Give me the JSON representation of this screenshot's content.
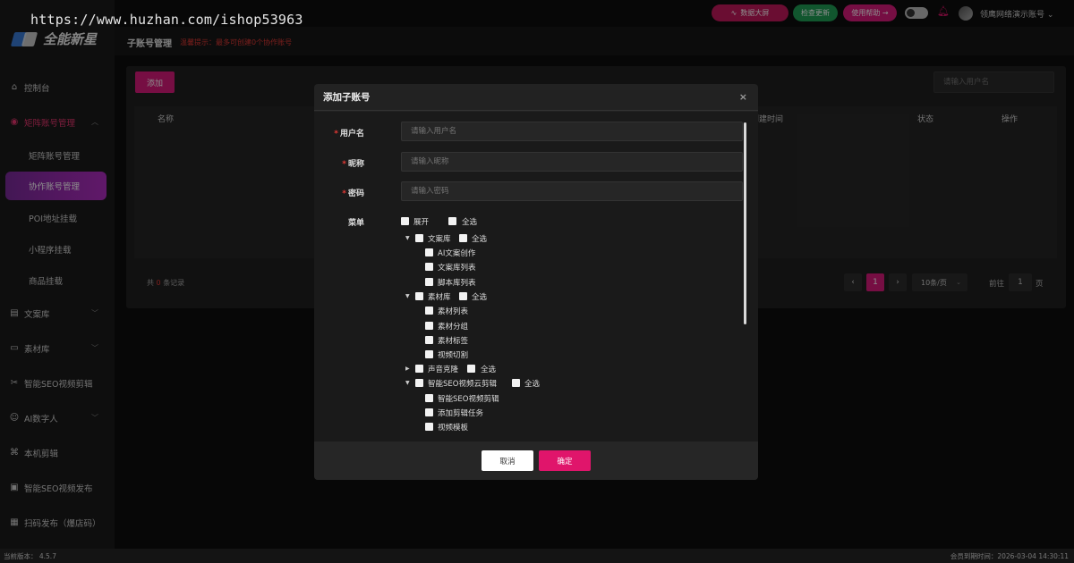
{
  "watermark": "https://www.huzhan.com/ishop53963",
  "brand": {
    "name": "全能新星"
  },
  "topbar": {
    "dashboard_label": "数据大屏",
    "check_update_label": "检查更新",
    "help_label": "使用帮助 →",
    "account_name": "领鹰网络演示账号",
    "account_chevron": "⌄"
  },
  "sidebar": {
    "items": [
      {
        "label": "控制台",
        "icon": "home-icon"
      },
      {
        "label": "矩阵账号管理",
        "icon": "matrix-icon",
        "expanded": true,
        "children": [
          "矩阵账号管理",
          "协作账号管理",
          "POI地址挂载",
          "小程序挂载",
          "商品挂载"
        ]
      },
      {
        "label": "文案库",
        "icon": "document-icon"
      },
      {
        "label": "素材库",
        "icon": "folder-icon"
      },
      {
        "label": "智能SEO视频剪辑",
        "icon": "scissors-icon"
      },
      {
        "label": "AI数字人",
        "icon": "ai-icon"
      },
      {
        "label": "本机剪辑",
        "icon": "cut-icon"
      },
      {
        "label": "智能SEO视频发布",
        "icon": "video-icon"
      },
      {
        "label": "扫码发布（爆店码）",
        "icon": "qrcode-icon"
      }
    ]
  },
  "header": {
    "title": "子账号管理",
    "tip": "温馨提示：最多可创建0个协作账号"
  },
  "main": {
    "add_label": "添加",
    "search_placeholder": "请输入用户名",
    "columns": [
      "名称",
      "创建时间",
      "状态",
      "操作"
    ],
    "total_prefix": "共",
    "total_count": "0",
    "total_suffix": "条记录",
    "pager": {
      "prev": "‹",
      "current": "1",
      "next": "›",
      "page_size": "10条/页",
      "goto_label": "前往",
      "goto_value": "1",
      "page_unit": "页"
    }
  },
  "modal": {
    "title": "添加子账号",
    "close": "×",
    "fields": {
      "username": {
        "label": "用户名",
        "placeholder": "请输入用户名"
      },
      "nickname": {
        "label": "昵称",
        "placeholder": "请输入昵称"
      },
      "password": {
        "label": "密码",
        "placeholder": "请输入密码"
      }
    },
    "menu_label": "菜单",
    "menu_top": {
      "expand": "展开",
      "select_all": "全选"
    },
    "select_all": "全选",
    "groups": [
      {
        "name": "文案库",
        "children": [
          "AI文案创作",
          "文案库列表",
          "脚本库列表"
        ]
      },
      {
        "name": "素材库",
        "children": [
          "素材列表",
          "素材分组",
          "素材标签",
          "视频切割"
        ]
      },
      {
        "name": "声音克隆",
        "children": []
      },
      {
        "name": "智能SEO视频云剪辑",
        "children": [
          "智能SEO视频剪辑",
          "添加剪辑任务",
          "视频模板"
        ]
      }
    ],
    "cancel_label": "取消",
    "ok_label": "确定"
  },
  "footer": {
    "version": "当前版本： 4.5.7",
    "expire": "会员到期时间：2026-03-04 14:30:11"
  },
  "colors": {
    "accent": "#d81b7a",
    "green": "#1f9d55",
    "danger": "#e53935",
    "sidebar_active": "#9b2bb5"
  }
}
